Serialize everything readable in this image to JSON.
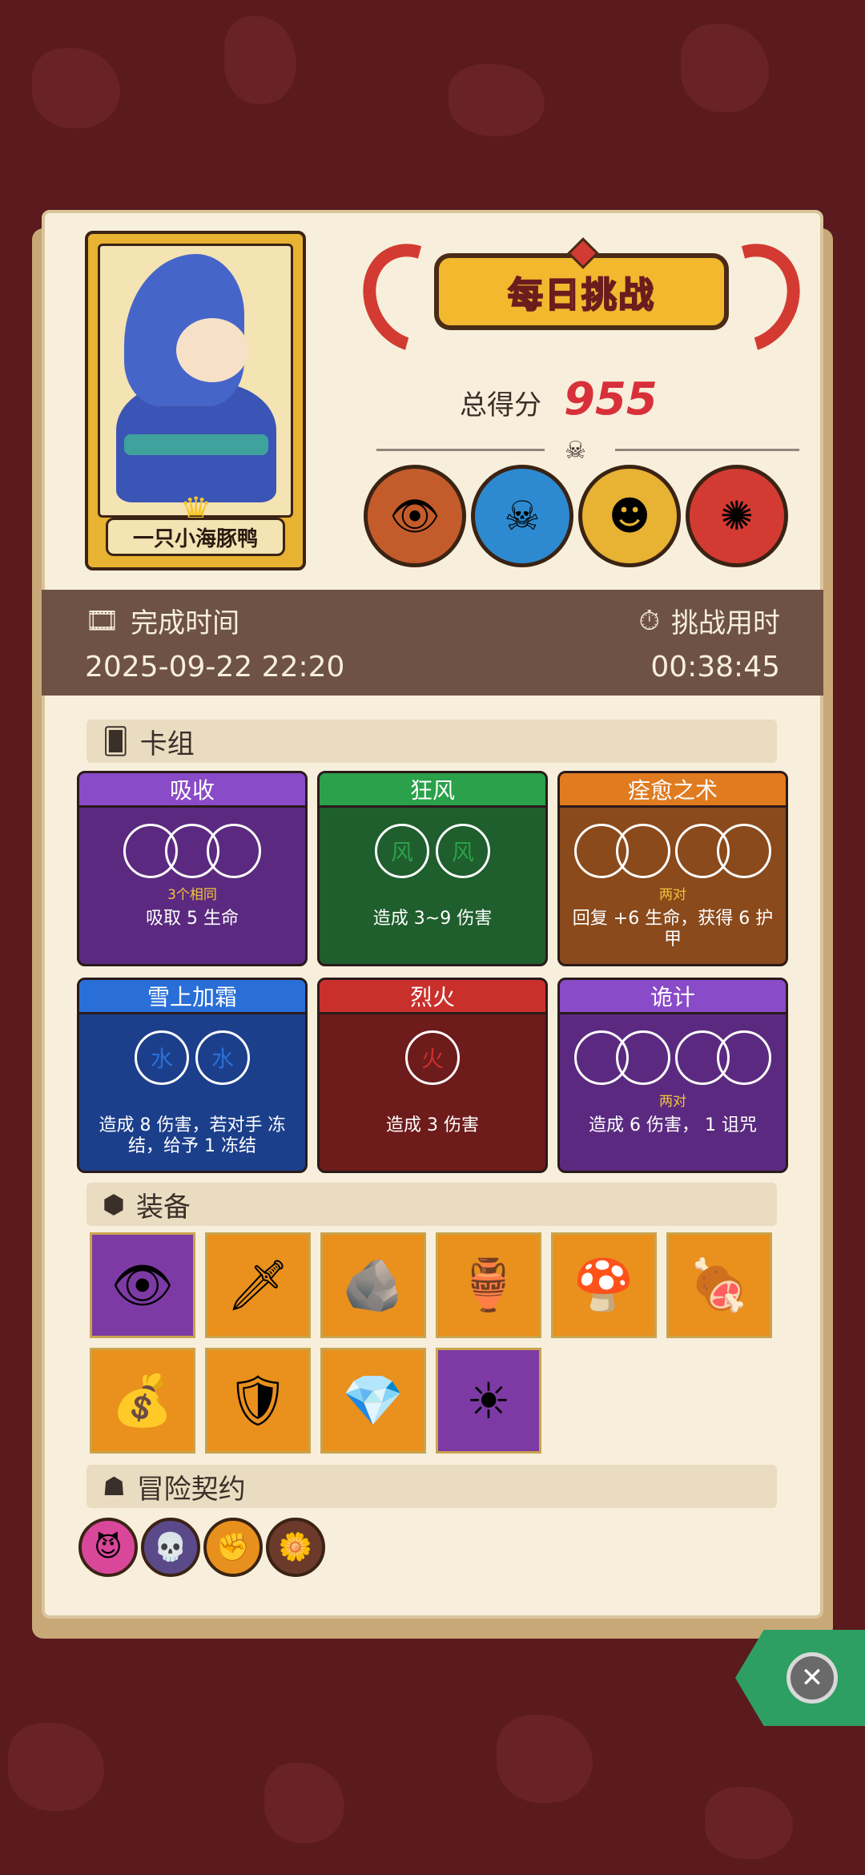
{
  "player": {
    "name": "一只小海豚鸭"
  },
  "header": {
    "title": "每日挑战",
    "score_label": "总得分",
    "score_value": "955"
  },
  "bosses": [
    {
      "icon": "cyclops-boss-icon",
      "color": "#c45b2a"
    },
    {
      "icon": "crowned-skull-boss-icon",
      "color": "#2d8ad0"
    },
    {
      "icon": "yellow-mask-boss-icon",
      "color": "#e8b232"
    },
    {
      "icon": "tribal-mask-boss-icon",
      "color": "#d33b32"
    }
  ],
  "info": {
    "finish_label": "完成时间",
    "finish_value": "2025-09-22 22:20",
    "duration_label": "挑战用时",
    "duration_value": "00:38:45"
  },
  "sections": {
    "deck": "卡组",
    "equipment": "装备",
    "contract": "冒险契约"
  },
  "deck": [
    {
      "name": "吸收",
      "head": "#8a4bc8",
      "body": "#5b2a80",
      "dice": [
        "",
        "",
        ""
      ],
      "cond": "3个相同",
      "effect": "吸取 5 生命"
    },
    {
      "name": "狂风",
      "head": "#2aa14a",
      "body": "#1f5e2d",
      "dice": [
        "风",
        "风"
      ],
      "cond": "",
      "effect": "造成 3~9 伤害"
    },
    {
      "name": "痊愈之术",
      "head": "#e07b20",
      "body": "#8a4a1c",
      "dice": [
        "",
        "",
        "",
        ""
      ],
      "cond": "两对",
      "effect": "回复 +6 生命，获得 6 护甲"
    },
    {
      "name": "雪上加霜",
      "head": "#2a6fd8",
      "body": "#1c3f8c",
      "dice": [
        "水",
        "水"
      ],
      "cond": "",
      "effect": "造成 8 伤害，若对手 冻结，给予 1 冻结"
    },
    {
      "name": "烈火",
      "head": "#c9302c",
      "body": "#6e1b1b",
      "dice": [
        "火"
      ],
      "cond": "",
      "effect": "造成 3 伤害"
    },
    {
      "name": "诡计",
      "head": "#8a4bc8",
      "body": "#5b2a80",
      "dice": [
        "",
        "",
        "",
        ""
      ],
      "cond": "两对",
      "effect": "造成 6 伤害， 1 诅咒"
    }
  ],
  "equipment": [
    {
      "icon": "blue-flame-eye-icon",
      "glyph": "👁",
      "bg": "purple"
    },
    {
      "icon": "ice-blade-icon",
      "glyph": "🗡",
      "bg": "orange"
    },
    {
      "icon": "moss-stone-icon",
      "glyph": "🪨",
      "bg": "orange"
    },
    {
      "icon": "jade-vase-icon",
      "glyph": "🏺",
      "bg": "orange"
    },
    {
      "icon": "blue-mushroom-icon",
      "glyph": "🍄",
      "bg": "orange"
    },
    {
      "icon": "meat-leg-icon",
      "glyph": "🍖",
      "bg": "orange"
    },
    {
      "icon": "coin-sack-icon",
      "glyph": "💰",
      "bg": "orange"
    },
    {
      "icon": "round-shield-icon",
      "glyph": "🛡",
      "bg": "orange"
    },
    {
      "icon": "ice-crystal-icon",
      "glyph": "💎",
      "bg": "orange"
    },
    {
      "icon": "sun-mask-icon",
      "glyph": "☀",
      "bg": "purple"
    }
  ],
  "contracts": [
    {
      "icon": "pink-demon-contract-icon",
      "glyph": "😈",
      "color": "#d9479a"
    },
    {
      "icon": "skull-wing-contract-icon",
      "glyph": "💀",
      "color": "#5a4a8a"
    },
    {
      "icon": "fist-contract-icon",
      "glyph": "✊",
      "color": "#e8901d"
    },
    {
      "icon": "flower-pot-contract-icon",
      "glyph": "🌼",
      "color": "#6b3a2a"
    }
  ]
}
